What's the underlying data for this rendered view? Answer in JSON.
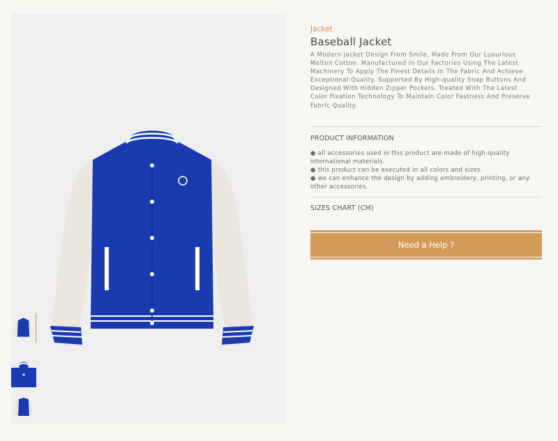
{
  "product": {
    "category": "Jacket",
    "title": "Baseball Jacket",
    "description": "A Modern Jacket Design From Smile, Made From Our Luxurious Melton Cotton. Manufactured In Our Factories Using The Latest Machinery To Apply The Finest Details In The Fabric And Achieve Exceptional Quality. Supported By High-quality Snap Buttons And Designed With Hidden Zipper Pockets. Treated With The Latest Color Fixation Technology To Maintain Color Fastness And Preserve Fabric Quality."
  },
  "product_info": {
    "heading": "PRODUCT INFORMATION",
    "bullets": [
      "● all accessories used in this product are made of high-quality international materials.",
      "● this product can be executed in all colors and sizes.",
      "● we can enhance the design by adding embroidery, printing, or any other accessories."
    ]
  },
  "sizes": {
    "heading": "SIZES CHART (CM)"
  },
  "help_button": {
    "label": "Need a Help ?"
  },
  "gallery": {
    "thumbnails": [
      "front-view",
      "collar-closeup",
      "back-view"
    ],
    "active_index": 0
  },
  "colors": {
    "accent": "#d39b5a",
    "jacket_body": "#1a3ab0",
    "sleeves": "#ebe7de",
    "background": "#f8f6f2"
  }
}
